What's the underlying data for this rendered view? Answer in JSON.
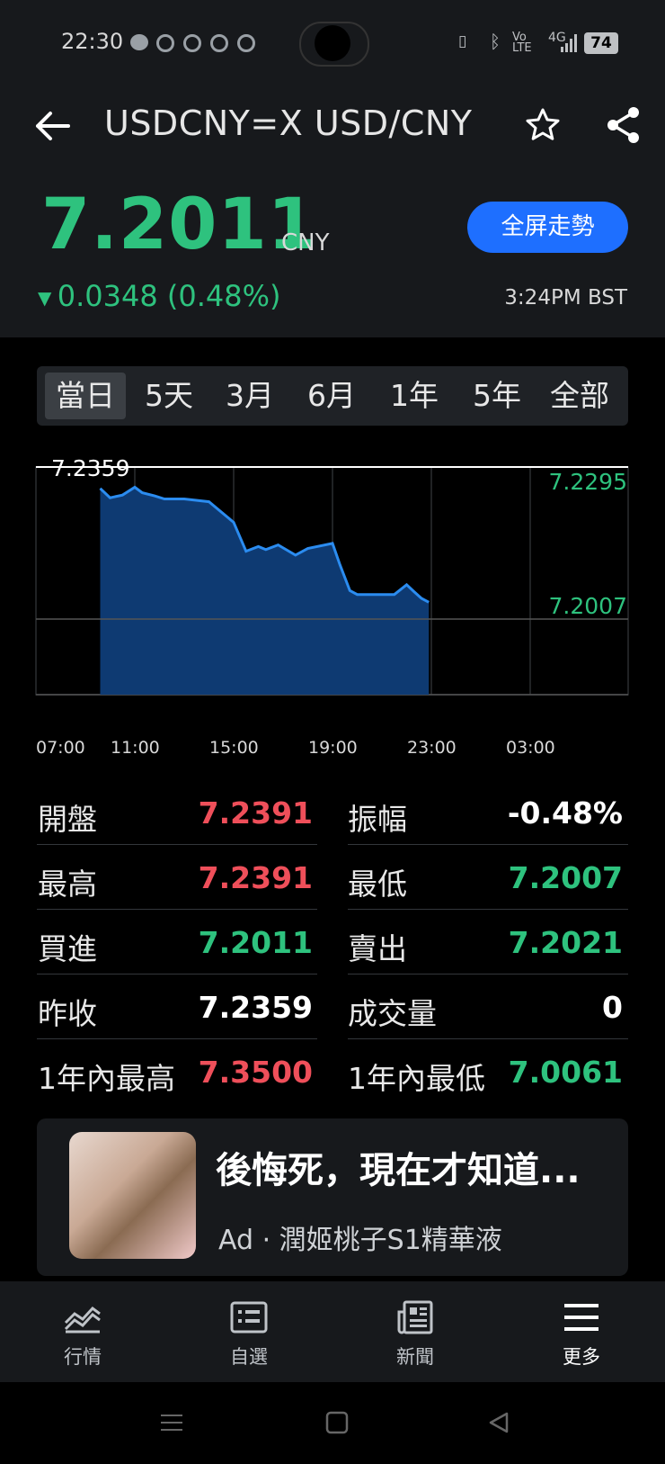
{
  "status_bar": {
    "time": "22:30",
    "battery": "74",
    "network": "4G"
  },
  "header": {
    "title": "USDCNY=X USD/CNY",
    "price": "7.2011",
    "currency": "CNY",
    "change": "0.0348 (0.48%)",
    "fullscreen_label": "全屏走勢",
    "timestamp": "3:24PM BST",
    "back_icon": "arrow-left-icon",
    "star_icon": "star-icon",
    "share_icon": "share-icon"
  },
  "range_tabs": [
    {
      "label": "當日",
      "selected": true
    },
    {
      "label": "5天"
    },
    {
      "label": "3月"
    },
    {
      "label": "6月"
    },
    {
      "label": "1年"
    },
    {
      "label": "5年"
    },
    {
      "label": "全部"
    }
  ],
  "chart_data": {
    "type": "area",
    "x_ticks": [
      "07:00",
      "11:00",
      "15:00",
      "19:00",
      "23:00",
      "03:00"
    ],
    "prev_close_label": "7.2359",
    "right_labels": [
      "7.2295",
      "7.2007"
    ],
    "ylim": [
      7.1775,
      7.2359
    ],
    "x_hours": [
      9.6,
      10.0,
      10.5,
      11.0,
      11.3,
      11.8,
      12.2,
      13.0,
      14.0,
      15.0,
      15.5,
      16.0,
      16.3,
      16.8,
      17.5,
      18.0,
      19.0,
      19.3,
      19.7,
      20.0,
      21.5,
      22.0,
      22.3,
      22.6,
      22.9
    ],
    "values": [
      7.2304,
      7.228,
      7.2287,
      7.2307,
      7.2293,
      7.2285,
      7.2277,
      7.2277,
      7.227,
      7.2217,
      7.2143,
      7.2155,
      7.2147,
      7.2159,
      7.2133,
      7.215,
      7.2163,
      7.2108,
      7.2042,
      7.2032,
      7.2032,
      7.2057,
      7.2039,
      7.2022,
      7.2012
    ],
    "line_color": "#2b8cf0",
    "fill_color": "#0e3a72"
  },
  "stats": {
    "left": [
      {
        "label": "開盤",
        "value": "7.2391",
        "color": "red"
      },
      {
        "label": "最高",
        "value": "7.2391",
        "color": "red"
      },
      {
        "label": "買進",
        "value": "7.2011",
        "color": "green"
      },
      {
        "label": "昨收",
        "value": "7.2359",
        "color": "white"
      },
      {
        "label": "1年內最高",
        "value": "7.3500",
        "color": "red"
      }
    ],
    "right": [
      {
        "label": "振幅",
        "value": "-0.48%",
        "color": "white"
      },
      {
        "label": "最低",
        "value": "7.2007",
        "color": "green"
      },
      {
        "label": "賣出",
        "value": "7.2021",
        "color": "green"
      },
      {
        "label": "成交量",
        "value": "0",
        "color": "white"
      },
      {
        "label": "1年內最低",
        "value": "7.0061",
        "color": "green"
      }
    ]
  },
  "ad": {
    "title": "後悔死，現在才知道...",
    "subtitle": "Ad · 潤姬桃子S1精華液"
  },
  "bottom_nav": [
    {
      "label": "行情",
      "icon": "market-chart-icon"
    },
    {
      "label": "自選",
      "icon": "watchlist-icon"
    },
    {
      "label": "新聞",
      "icon": "news-icon"
    },
    {
      "label": "更多",
      "icon": "menu-icon"
    }
  ],
  "colors": {
    "green": "#2ec27e",
    "red": "#ef4f5a",
    "accent": "#1e6fff"
  }
}
